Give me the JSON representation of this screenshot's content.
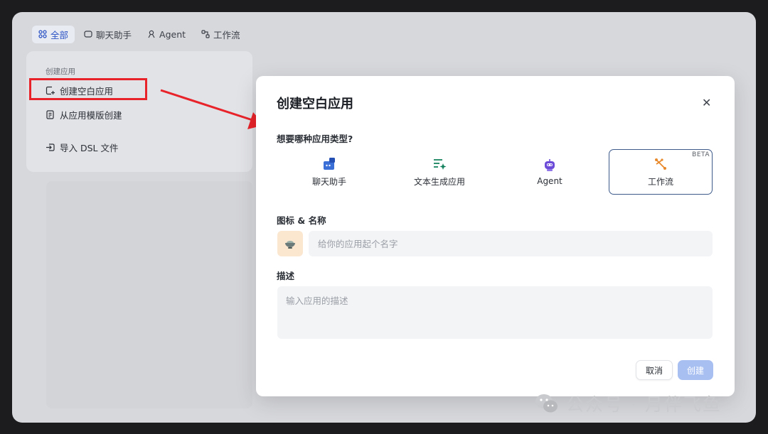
{
  "tabs": [
    {
      "label": "全部",
      "icon": "grid-icon"
    },
    {
      "label": "聊天助手",
      "icon": "chat-icon"
    },
    {
      "label": "Agent",
      "icon": "agent-icon"
    },
    {
      "label": "工作流",
      "icon": "workflow-icon"
    }
  ],
  "sidebar": {
    "title": "创建应用",
    "items": [
      {
        "label": "创建空白应用",
        "icon": "new-file-icon"
      },
      {
        "label": "从应用模版创建",
        "icon": "template-icon"
      },
      {
        "label": "导入 DSL 文件",
        "icon": "import-icon"
      }
    ]
  },
  "modal": {
    "title": "创建空白应用",
    "type_question": "想要哪种应用类型?",
    "types": [
      {
        "label": "聊天助手",
        "icon": "chat-assistant-icon"
      },
      {
        "label": "文本生成应用",
        "icon": "text-generation-icon"
      },
      {
        "label": "Agent",
        "icon": "robot-icon"
      },
      {
        "label": "工作流",
        "icon": "workflow-icon",
        "badge": "BETA",
        "selected": true
      }
    ],
    "icon_name_label": "图标 & 名称",
    "name_placeholder": "给你的应用起个名字",
    "desc_label": "描述",
    "desc_placeholder": "输入应用的描述",
    "cancel_label": "取消",
    "create_label": "创建"
  },
  "watermark": "公众号 · 月伴飞鱼",
  "colors": {
    "accent": "#2e55c5",
    "highlight_red": "#e8232a",
    "create_button": "#a8bff2",
    "icon_bg": "#fbe6d0"
  }
}
